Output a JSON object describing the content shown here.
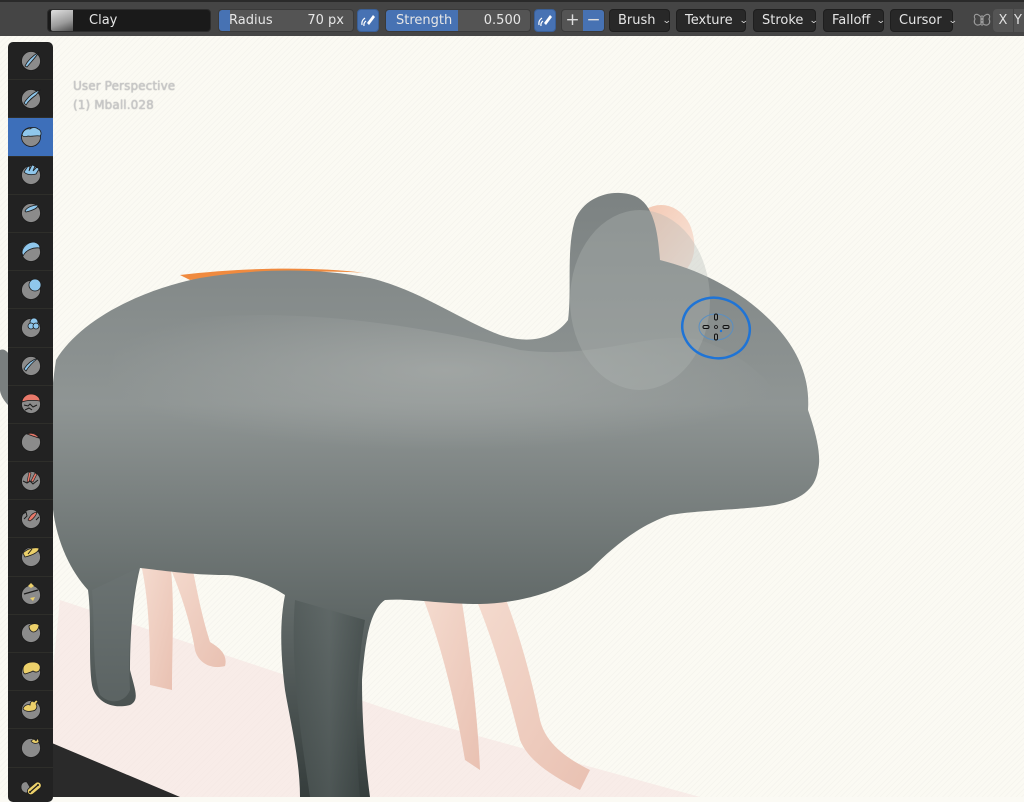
{
  "header": {
    "brush_name": "Clay",
    "radius": {
      "label": "Radius",
      "value": "70 px",
      "fill_fraction": 0.08
    },
    "strength": {
      "label": "Strength",
      "value": "0.500",
      "fill_fraction": 0.5
    },
    "direction": {
      "add_label": "+",
      "subtract_label": "−",
      "active": "subtract"
    },
    "menus": [
      {
        "label": "Brush",
        "icon": "chevron-down-icon"
      },
      {
        "label": "Texture",
        "icon": "chevron-down-icon"
      },
      {
        "label": "Stroke",
        "icon": "chevron-down-icon"
      },
      {
        "label": "Falloff",
        "icon": "chevron-down-icon"
      },
      {
        "label": "Cursor",
        "icon": "chevron-down-icon"
      }
    ],
    "symmetry_icon": "butterfly-symmetry-icon",
    "axis_x": "X",
    "axis_y": "Y"
  },
  "viewport": {
    "view_label": "User Perspective",
    "object_label": "(1) Mball.028"
  },
  "toolbar": {
    "active_index": 2,
    "tools": [
      {
        "name": "draw",
        "color": "#8fc7ec"
      },
      {
        "name": "draw-sharp",
        "color": "#8fc7ec"
      },
      {
        "name": "clay",
        "color": "#8fc7ec"
      },
      {
        "name": "clay-strips",
        "color": "#8fc7ec"
      },
      {
        "name": "clay-thumb",
        "color": "#8fc7ec"
      },
      {
        "name": "layer",
        "color": "#8fc7ec"
      },
      {
        "name": "inflate",
        "color": "#8fc7ec"
      },
      {
        "name": "blob",
        "color": "#8fc7ec"
      },
      {
        "name": "crease",
        "color": "#8fc7ec"
      },
      {
        "name": "smooth",
        "color": "#e8796a"
      },
      {
        "name": "flatten",
        "color": "#e8796a"
      },
      {
        "name": "fill",
        "color": "#e8796a"
      },
      {
        "name": "scrape",
        "color": "#e8796a"
      },
      {
        "name": "multiplane-scrape",
        "color": "#ecd06a"
      },
      {
        "name": "pinch",
        "color": "#ecd06a"
      },
      {
        "name": "grab",
        "color": "#ecd06a"
      },
      {
        "name": "elastic-deform",
        "color": "#ecd06a"
      },
      {
        "name": "snake-hook",
        "color": "#ecd06a"
      },
      {
        "name": "thumb",
        "color": "#ecd06a"
      },
      {
        "name": "pose",
        "color": "#ecd06a"
      }
    ]
  },
  "colors": {
    "accent": "#4772b3",
    "header_bg": "#454545",
    "toolbar_bg": "#222222",
    "brush_cursor": "#1f74d6"
  }
}
